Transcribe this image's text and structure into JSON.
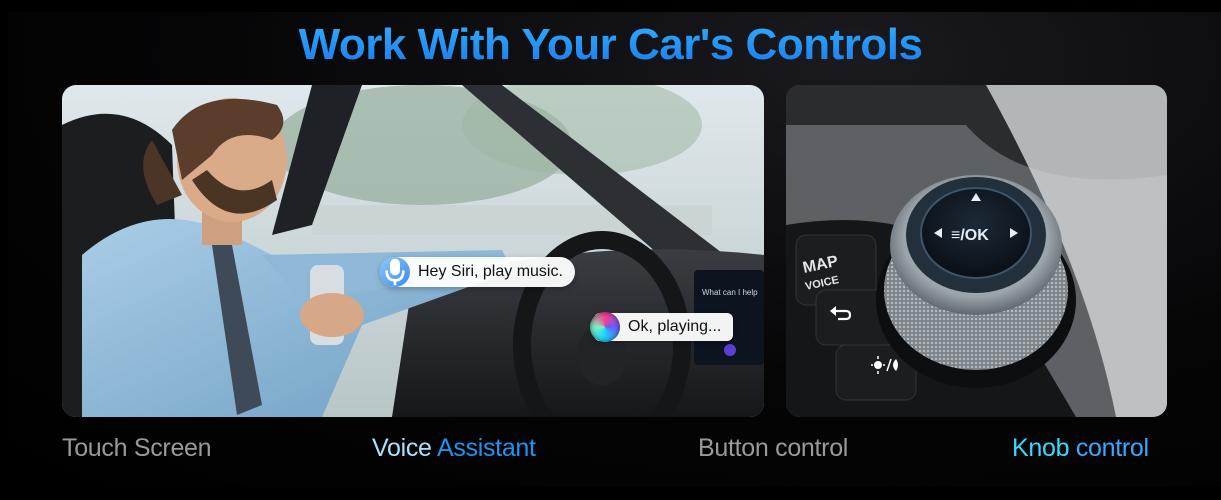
{
  "header": {
    "title": "Work With Your Car's Controls"
  },
  "scene": {
    "siri_question": "Hey Siri, play music.",
    "siri_answer": "Ok, playing...",
    "screen_prompt": "What can I help you with?",
    "panel_map_voice": [
      "MAP",
      "VOICE"
    ],
    "knob_ok": "☰/OK"
  },
  "features": {
    "touch": "Touch Screen",
    "voice_a": "Voice",
    "voice_b": "Assistant",
    "button": "Button control",
    "knob_a": "Knob",
    "knob_b": "control"
  },
  "colors": {
    "title_blue": "#1d8cf2",
    "accent_light": "#a8e1ff",
    "accent_blue": "#1f93f4",
    "label_gray": "#9a9a9a"
  },
  "icons": [
    "microphone-icon",
    "siri-icon",
    "back-arrow-icon",
    "brightness-icon"
  ]
}
